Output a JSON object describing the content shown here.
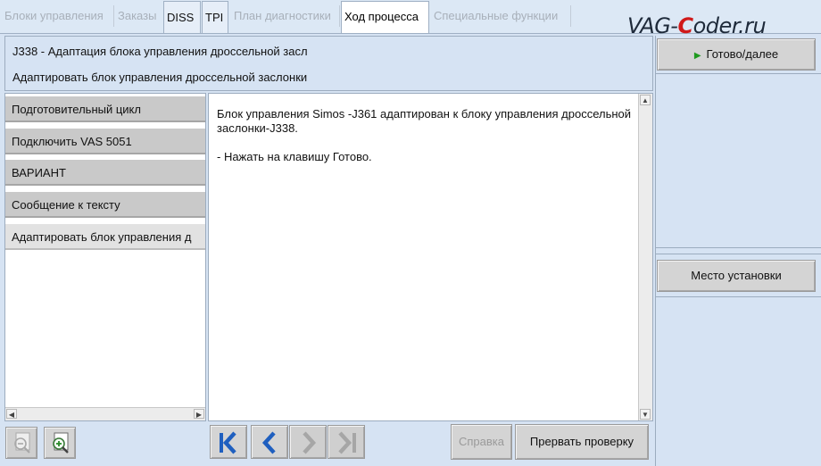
{
  "tabs": [
    {
      "label": "Блоки управления",
      "state": "disabled"
    },
    {
      "label": "Заказы",
      "state": "disabled"
    },
    {
      "label": "DISS",
      "state": "normal"
    },
    {
      "label": "TPI",
      "state": "normal"
    },
    {
      "label": "План диагностики",
      "state": "disabled"
    },
    {
      "label": "Ход процесса",
      "state": "active"
    },
    {
      "label": "Специальные функции",
      "state": "disabled"
    }
  ],
  "watermark": {
    "part1": "VAG-",
    "part2": "C",
    "part3": "oder.ru"
  },
  "header": {
    "line1": "J338 - Адаптация блока управления дроссельной засл",
    "line2": "Адаптировать блок управления дроссельной заслонки"
  },
  "steps": [
    {
      "label": "Подготовительный цикл"
    },
    {
      "label": "Подключить VAS 5051"
    },
    {
      "label": "ВАРИАНТ"
    },
    {
      "label": "Сообщение к тексту"
    },
    {
      "label": "Адаптировать блок управления д"
    }
  ],
  "message": {
    "paragraph1": "Блок управления Simos -J361 адаптирован к блоку управления дроссельной заслонки-J338.",
    "paragraph2": "- Нажать на клавишу Готово."
  },
  "right_panel": {
    "ready_button": "Готово/далее",
    "location_button": "Место установки"
  },
  "bottom": {
    "help_button": "Справка",
    "abort_button": "Прервать проверку"
  },
  "icons": {
    "zoom_out": "zoom-out-icon",
    "zoom_in": "zoom-in-icon",
    "first": "first-icon",
    "back": "back-icon",
    "forward": "forward-icon",
    "last": "last-icon",
    "play": "play-icon"
  },
  "colors": {
    "background": "#d6e3f3",
    "nav_blue": "#1f5fbf",
    "play_green": "#1f9a1f",
    "watermark_red": "#d01a1a"
  }
}
